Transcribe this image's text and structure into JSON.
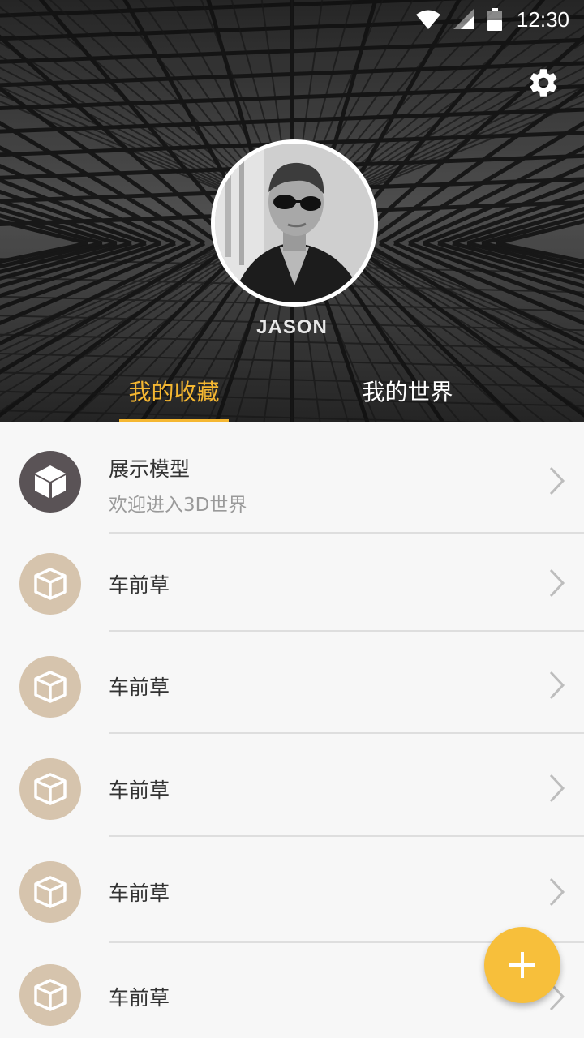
{
  "status_bar": {
    "time": "12:30",
    "icons": [
      "wifi-icon",
      "signal-icon",
      "battery-icon"
    ]
  },
  "header": {
    "settings_icon": "gear-icon",
    "username": "JASON",
    "tabs": [
      {
        "label": "我的收藏",
        "active": true
      },
      {
        "label": "我的世界",
        "active": false
      }
    ]
  },
  "colors": {
    "accent": "#f5b731",
    "fab": "#f7bf3b",
    "featured_icon_bg": "#5a5356",
    "item_icon_bg": "#d6c4ad",
    "list_bg": "#f7f7f7",
    "divider": "#dedede"
  },
  "list": {
    "items": [
      {
        "title": "展示模型",
        "subtitle": "欢迎进入3D世界",
        "icon": "cube-icon",
        "featured": true
      },
      {
        "title": "车前草",
        "icon": "cube-outline-icon"
      },
      {
        "title": "车前草",
        "icon": "cube-outline-icon"
      },
      {
        "title": "车前草",
        "icon": "cube-outline-icon"
      },
      {
        "title": "车前草",
        "icon": "cube-outline-icon"
      },
      {
        "title": "车前草",
        "icon": "cube-outline-icon"
      }
    ]
  },
  "fab": {
    "icon": "plus-icon"
  }
}
